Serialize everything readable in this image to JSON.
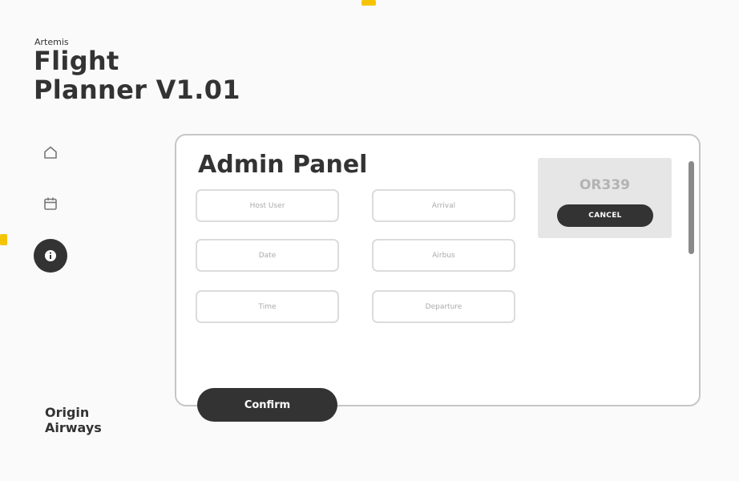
{
  "app": {
    "subtitle": "Artemis",
    "title_line1": "Flight",
    "title_line2": "Planner V1.01"
  },
  "nav": {
    "items": [
      {
        "icon": "home-icon"
      },
      {
        "icon": "calendar-icon"
      },
      {
        "icon": "info-icon",
        "active": true
      }
    ]
  },
  "panel": {
    "title": "Admin Panel",
    "fields": {
      "host_user": {
        "placeholder": "Host User",
        "value": ""
      },
      "arrival": {
        "placeholder": "Arrival",
        "value": ""
      },
      "date": {
        "placeholder": "Date",
        "value": ""
      },
      "airbus": {
        "placeholder": "Airbus",
        "value": ""
      },
      "time": {
        "placeholder": "Time",
        "value": ""
      },
      "departure": {
        "placeholder": "Departure",
        "value": ""
      }
    },
    "flight_card": {
      "code": "OR339",
      "cancel_label": "CANCEL"
    },
    "confirm_label": "Confirm"
  },
  "footer": {
    "line1": "Origin",
    "line2": "Airways"
  },
  "colors": {
    "primary": "#333333",
    "background": "#fafafa",
    "card": "#e6e6e6",
    "accent_marker": "#f5c400"
  }
}
